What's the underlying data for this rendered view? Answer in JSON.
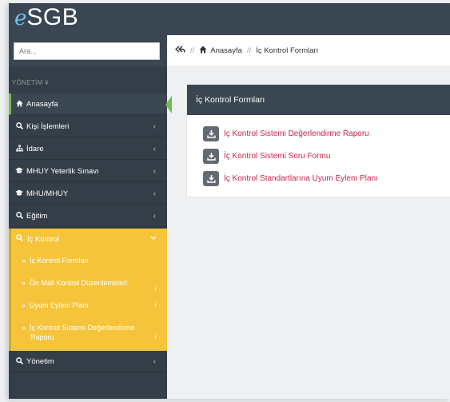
{
  "app": {
    "logo_e": "e",
    "logo_rest": "SGB"
  },
  "search": {
    "placeholder": "Ara..."
  },
  "sidebar": {
    "section_header": "YÖNETİM ¥",
    "items": [
      {
        "label": "Anasayfa"
      },
      {
        "label": "Kişi İşlemleri"
      },
      {
        "label": "İdare"
      },
      {
        "label": "MHUY Yeterlik Sınavı"
      },
      {
        "label": "MHU/MHUY"
      },
      {
        "label": "Eğitim"
      }
    ],
    "active_group": {
      "label": "İç Kontrol",
      "sub_items": [
        {
          "label": "İç Kontrol Formları"
        },
        {
          "label": "Ön Mali Kontrol Düzenlemeleri"
        },
        {
          "label": "Uyum Eylem Planı"
        },
        {
          "label": "İç Kontrol Sistemi Değerlendirme",
          "label2": "Raporu"
        }
      ]
    },
    "after_items": [
      {
        "label": "Yönetim"
      }
    ],
    "chevron": "‹",
    "arrow": "»"
  },
  "breadcrumb": {
    "sep": "//",
    "home": "Anasayfa",
    "current": "İç Kontrol Formları"
  },
  "panel": {
    "title": "İç Kontrol Formları",
    "links": [
      {
        "label": "İç Kontrol Sistemi Değerlendirme Raporu"
      },
      {
        "label": "İç Kontrol Sistemi Soru Formu"
      },
      {
        "label": "İç Kontrol Standartlarına Uyum Eylem Planı"
      }
    ]
  },
  "colors": {
    "topbar": "#3a4651",
    "sidebar": "#343e48",
    "active_submenu": "#f6c43b",
    "active_marker": "#6fbf4e",
    "link": "#c7254e"
  }
}
